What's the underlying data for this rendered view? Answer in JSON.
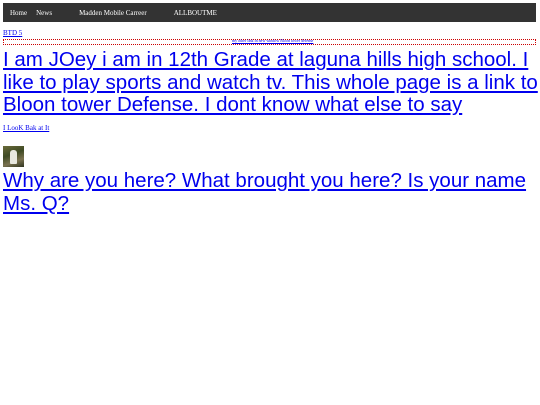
{
  "nav": {
    "items": [
      {
        "label": "Home"
      },
      {
        "label": "News"
      },
      {
        "label": "Madden Mobile Carreer"
      },
      {
        "label": "ALLBOUTME"
      }
    ]
  },
  "links": {
    "btd": "BTD 5",
    "banner_small": "my other link in new window Bloon tower defense",
    "main": "I am JOey i am in 12th Grade at laguna hills high school. I like to play sports and watch tv. This whole page is a link to Bloon tower Defense. I dont know what else to say",
    "look": "I LooK Bak at It",
    "question": "Why are you here? What brought you here? Is your name Ms. Q?"
  },
  "images": {
    "thumbnail": "football-player-photo"
  },
  "colors": {
    "navbar_bg": "#333333",
    "link": "#0000ee",
    "dotted_border": "#cc0000"
  }
}
